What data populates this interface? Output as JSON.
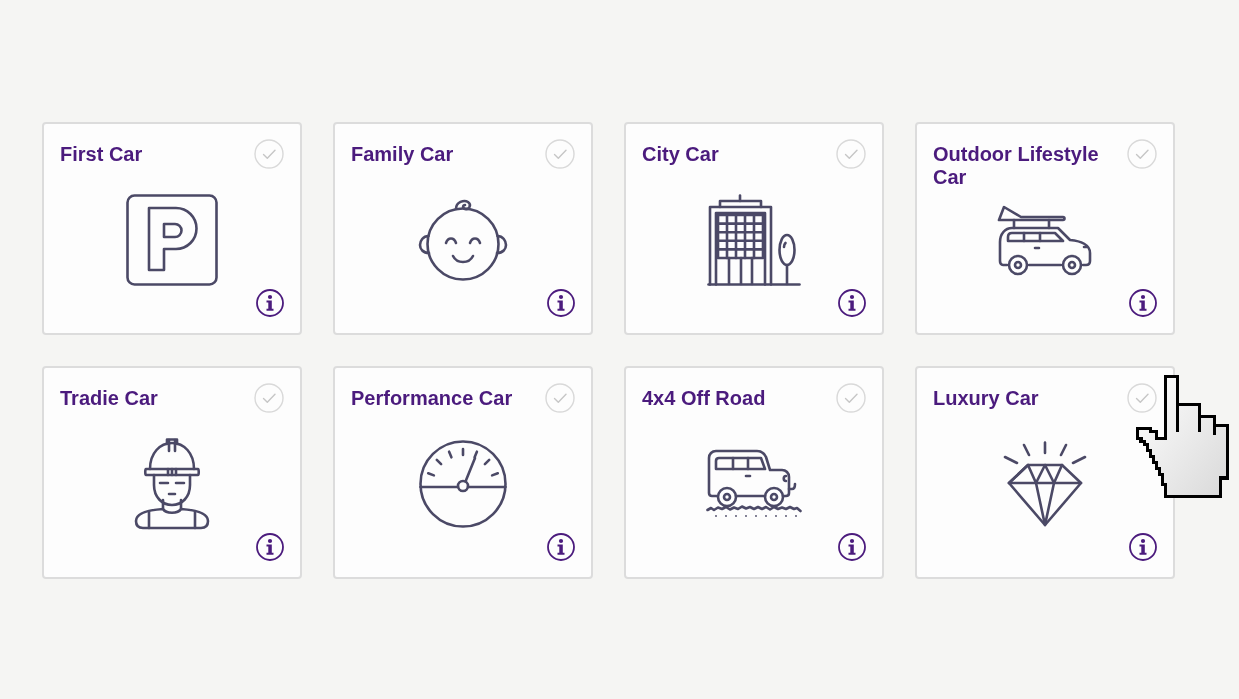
{
  "cards": [
    {
      "title": "First Car",
      "selected": false
    },
    {
      "title": "Family Car",
      "selected": false
    },
    {
      "title": "City Car",
      "selected": false
    },
    {
      "title": "Outdoor Lifestyle Car",
      "selected": false
    },
    {
      "title": "Tradie Car",
      "selected": false
    },
    {
      "title": "Performance Car",
      "selected": false
    },
    {
      "title": "4x4 Off Road",
      "selected": false
    },
    {
      "title": "Luxury Car",
      "selected": false
    }
  ]
}
